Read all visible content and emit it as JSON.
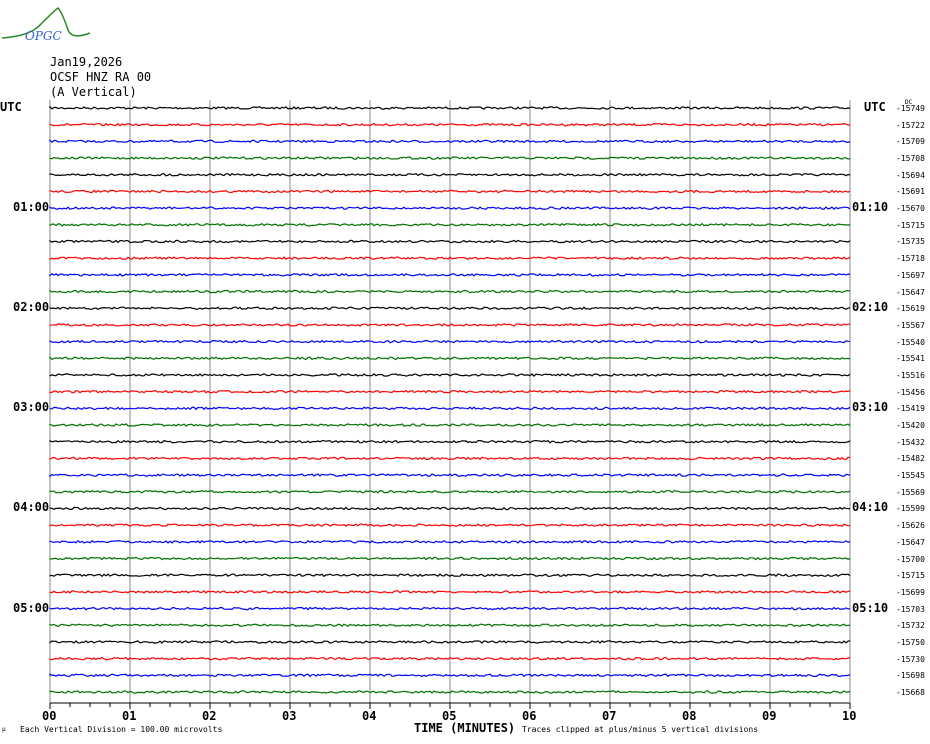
{
  "header": {
    "date": "Jan19,2026",
    "station": "OCSF HNZ RA 00",
    "component": "(A Vertical)",
    "logo_text": "OPGC"
  },
  "chart_data": {
    "type": "line",
    "title": "Helicorder OCSF HNZ RA 00",
    "xlabel": "TIME (MINUTES)",
    "xlim": [
      0,
      10
    ],
    "x_ticks": [
      "00",
      "01",
      "02",
      "03",
      "04",
      "05",
      "06",
      "07",
      "08",
      "09",
      "10"
    ],
    "left_axis_label": "UTC",
    "right_axis_label": "UTC",
    "dc_label": "DC",
    "minutes_per_line": 10,
    "left_hour_labels": [
      {
        "row": 6,
        "label": "01:00"
      },
      {
        "row": 12,
        "label": "02:00"
      },
      {
        "row": 18,
        "label": "03:00"
      },
      {
        "row": 24,
        "label": "04:00"
      },
      {
        "row": 30,
        "label": "05:00"
      }
    ],
    "right_hour_labels": [
      {
        "row": 6,
        "label": "01:10"
      },
      {
        "row": 12,
        "label": "02:10"
      },
      {
        "row": 18,
        "label": "03:10"
      },
      {
        "row": 24,
        "label": "04:10"
      },
      {
        "row": 30,
        "label": "05:10"
      }
    ],
    "dc_offsets": [
      -15749,
      -15722,
      -15709,
      -15708,
      -15694,
      -15691,
      -15670,
      -15715,
      -15735,
      -15718,
      -15697,
      -15647,
      -15619,
      -15567,
      -15540,
      -15541,
      -15516,
      -15456,
      -15419,
      -15420,
      -15432,
      -15482,
      -15545,
      -15569,
      -15599,
      -15626,
      -15647,
      -15700,
      -15715,
      -15699,
      -15703,
      -15732,
      -15750,
      -15730,
      -15698,
      -15668
    ],
    "trace_colors": [
      "#000000",
      "#ff0000",
      "#0000ff",
      "#007000"
    ],
    "scale_note": "Each Vertical Division =  100.00 microvolts",
    "clip_note": "Traces clipped at plus/minus 5 vertical divisions"
  }
}
